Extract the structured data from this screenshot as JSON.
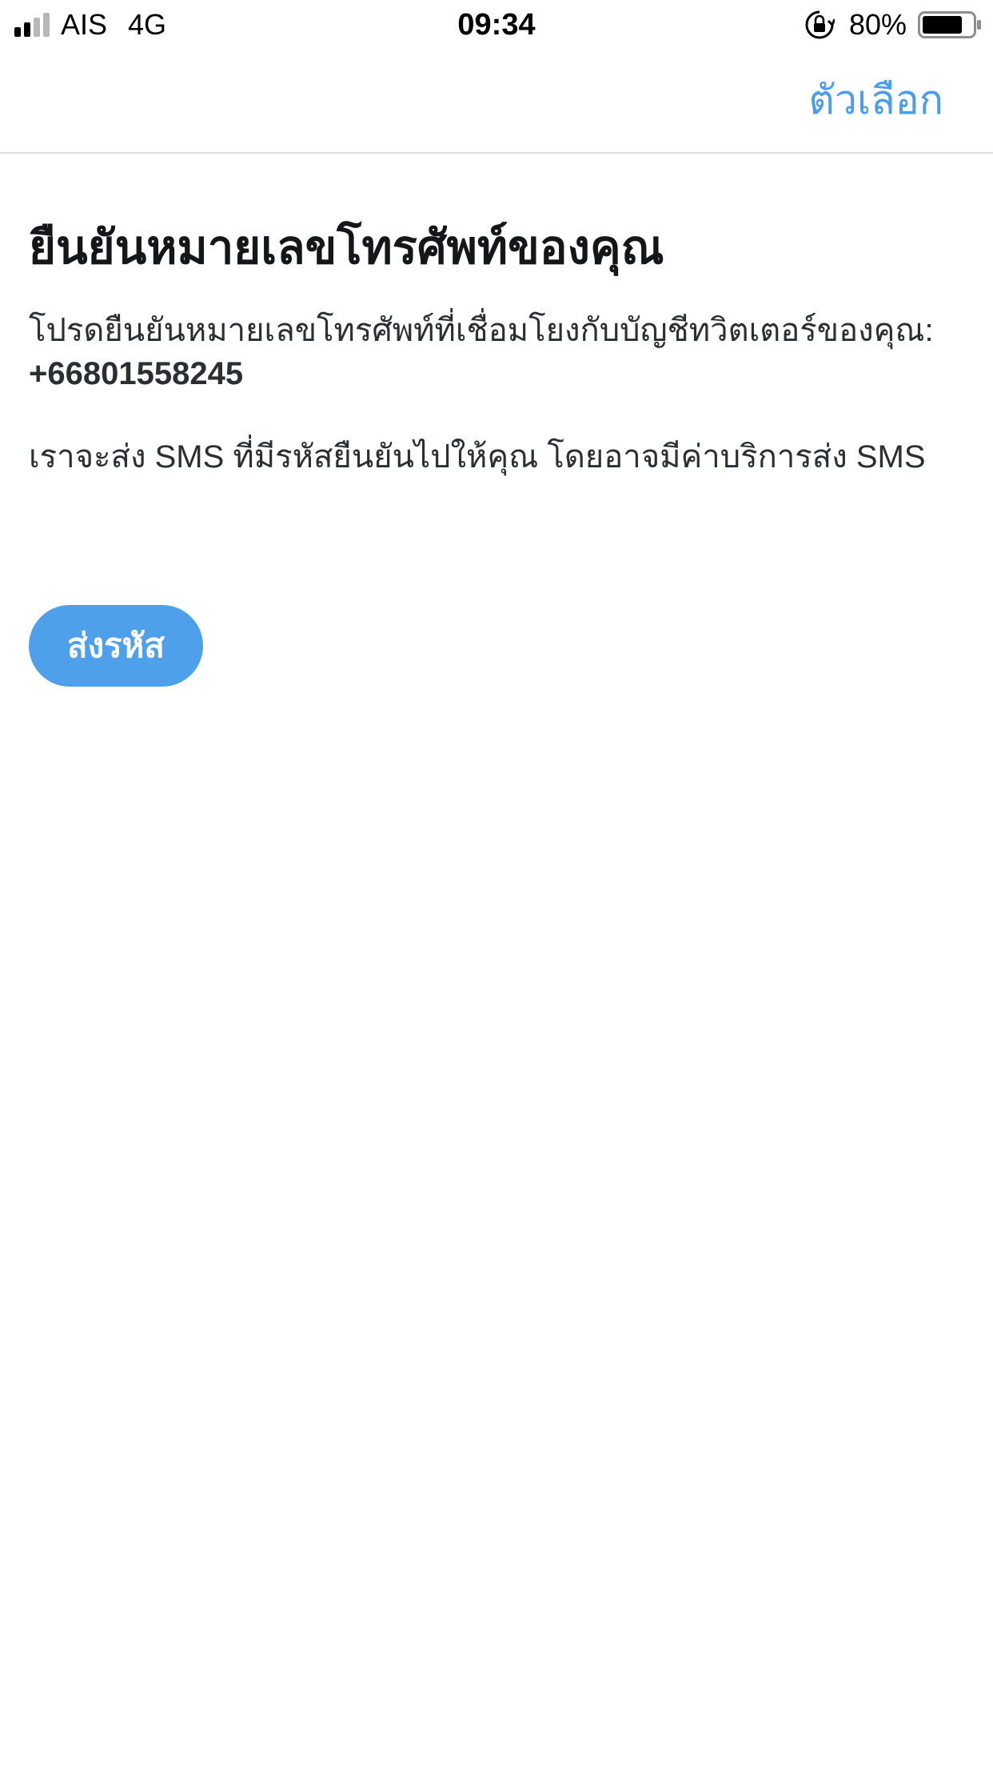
{
  "status_bar": {
    "carrier": "AIS",
    "network": "4G",
    "time": "09:34",
    "battery_percent": "80%",
    "signal_bars_filled": 2,
    "signal_bars_total": 4,
    "battery_level": 0.8
  },
  "nav": {
    "options_label": "ตัวเลือก"
  },
  "main": {
    "title": "ยืนยันหมายเลขโทรศัพท์ของคุณ",
    "description": "โปรดยืนยันหมายเลขโทรศัพท์ที่เชื่อมโยงกับบัญชีทวิตเตอร์ของคุณ:",
    "phone_number": "+66801558245",
    "sms_note": "เราจะส่ง SMS ที่มีรหัสยืนยันไปให้คุณ โดยอาจมีค่าบริการส่ง SMS",
    "send_button_label": "ส่งรหัส"
  },
  "colors": {
    "accent": "#4a9de8",
    "button_bg": "#4ea0ea",
    "text": "#14171a"
  }
}
